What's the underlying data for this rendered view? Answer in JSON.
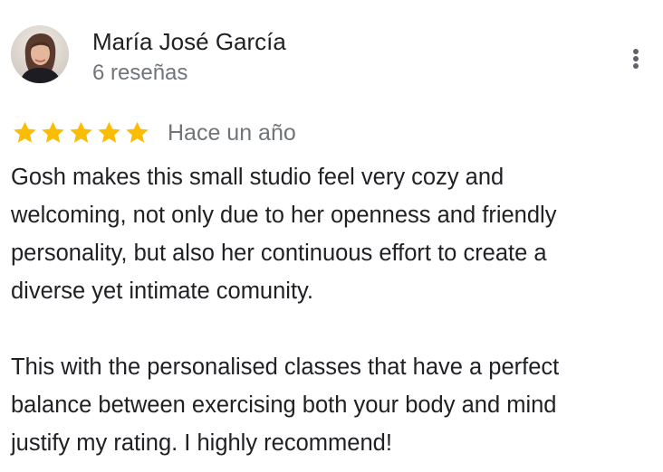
{
  "review": {
    "author": {
      "name": "María José García",
      "review_count": "6 reseñas",
      "avatar_icon": "user-avatar-photo"
    },
    "menu_icon": "more-vert-icon",
    "rating": {
      "stars": 5,
      "max_stars": 5,
      "star_icon": "star-icon",
      "star_color": "#fbbc04"
    },
    "date": "Hace un año",
    "body": {
      "paragraph_1": [
        "Gosh makes this small studio feel very cozy and",
        "welcoming, not only due to her openness and friendly",
        "personality, but also her continuous effort to create a",
        "diverse yet intimate comunity."
      ],
      "paragraph_2": [
        "This with the personalised classes that have a perfect",
        "balance between exercising both your body and mind",
        "justify my rating. I highly recommend!"
      ]
    }
  },
  "colors": {
    "primary_text": "#202124",
    "secondary_text": "#70757a",
    "icon": "#5f6368"
  }
}
